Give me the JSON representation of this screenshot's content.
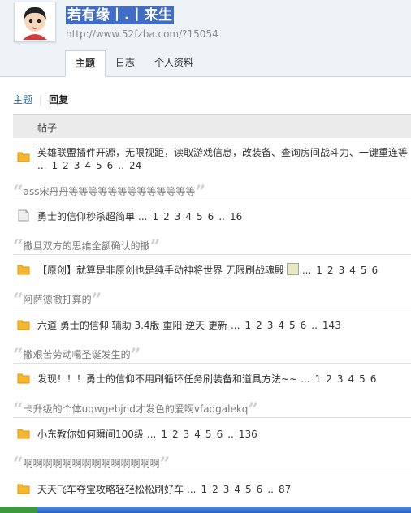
{
  "header": {
    "username": "若有缘丨.丨来生",
    "url": "http://www.52fzba.com/?15054",
    "tabs": [
      "主题",
      "日志",
      "个人资料"
    ]
  },
  "subnav": {
    "topics": "主题",
    "sep": "|",
    "replies": "回复"
  },
  "table": {
    "column_header": "帖子"
  },
  "threads": [
    {
      "title": "英雄联盟插件开源，无限视距，读取游戏信息，改装备、查询房间战斗力、一键重连等",
      "pages_prefix": "...",
      "pages": [
        "1",
        "2",
        "3",
        "4",
        "5",
        "6",
        "..",
        "24"
      ],
      "quote": "ass宋丹丹等等等等等等等等等等等等等",
      "icon": "folder-icon"
    },
    {
      "title": "勇士的信仰秒杀超简单",
      "pages_prefix": "...",
      "pages": [
        "1",
        "2",
        "3",
        "4",
        "5",
        "6",
        "..",
        "16"
      ],
      "quote": "撒旦双方的思维全额确认的撤",
      "icon": "doc-icon"
    },
    {
      "title": "【原创】就算是非原创也是纯手动神将世界 无限刷战魂殿",
      "pages_prefix": "...",
      "pages": [
        "1",
        "2",
        "3",
        "4",
        "5",
        "6"
      ],
      "quote": "阿萨德撤打算的",
      "icon": "folder-icon"
    },
    {
      "title": "六道 勇士的信仰 辅助 3.4版 重阳 逆天 更新",
      "pages_prefix": "...",
      "pages": [
        "1",
        "2",
        "3",
        "4",
        "5",
        "6",
        "..",
        "143"
      ],
      "quote": "撒艰苦劳动噶圣诞发生的",
      "icon": "folder-icon"
    },
    {
      "title": "发现！！！勇士的信仰不用刷循环任务刷装备和道具方法~~",
      "pages_prefix": "...",
      "pages": [
        "1",
        "2",
        "3",
        "4",
        "5",
        "6"
      ],
      "quote": "卡升级的个体uqwgebjnd才发色的爱啊vfadgalekq",
      "icon": "folder-icon"
    },
    {
      "title": "小东教你如何瞬间100级",
      "pages_prefix": "...",
      "pages": [
        "1",
        "2",
        "3",
        "4",
        "5",
        "6",
        "..",
        "136"
      ],
      "quote": "啊啊啊啊啊啊啊啊啊啊啊啊啊啊",
      "icon": "folder-icon"
    },
    {
      "title": "天天飞车夺宝攻略轻轻松松刷好车",
      "pages_prefix": "...",
      "pages": [
        "1",
        "2",
        "3",
        "4",
        "5",
        "6",
        "..",
        "87"
      ],
      "quote": "",
      "icon": "folder-icon"
    }
  ],
  "colors": {
    "link": "#336699",
    "name_bg": "#3f6dc7",
    "folder": "#f5b731"
  }
}
